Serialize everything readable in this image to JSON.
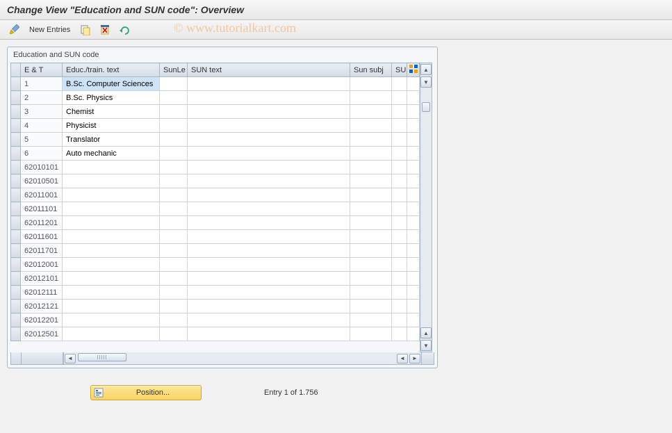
{
  "header": {
    "title": "Change View \"Education and SUN code\": Overview"
  },
  "toolbar": {
    "new_entries_label": "New Entries"
  },
  "watermark": "© www.tutorialkart.com",
  "panel": {
    "title": "Education and SUN code"
  },
  "columns": {
    "et": "E & T",
    "train": "Educ./train. text",
    "sunle": "SunLe",
    "suntext": "SUN text",
    "sunsubj": "Sun subj",
    "su": "SU"
  },
  "rows": [
    {
      "et": "1",
      "train": "B.Sc. Computer Sciences",
      "selected": true
    },
    {
      "et": "2",
      "train": "B.Sc. Physics"
    },
    {
      "et": "3",
      "train": "Chemist"
    },
    {
      "et": "4",
      "train": "Physicist"
    },
    {
      "et": "5",
      "train": "Translator"
    },
    {
      "et": "6",
      "train": "Auto mechanic"
    },
    {
      "et": "62010101",
      "train": ""
    },
    {
      "et": "62010501",
      "train": ""
    },
    {
      "et": "62011001",
      "train": ""
    },
    {
      "et": "62011101",
      "train": ""
    },
    {
      "et": "62011201",
      "train": ""
    },
    {
      "et": "62011601",
      "train": ""
    },
    {
      "et": "62011701",
      "train": ""
    },
    {
      "et": "62012001",
      "train": ""
    },
    {
      "et": "62012101",
      "train": ""
    },
    {
      "et": "62012111",
      "train": ""
    },
    {
      "et": "62012121",
      "train": ""
    },
    {
      "et": "62012201",
      "train": ""
    },
    {
      "et": "62012501",
      "train": ""
    }
  ],
  "footer": {
    "position_label": "Position...",
    "entry_text": "Entry 1 of 1.756"
  }
}
